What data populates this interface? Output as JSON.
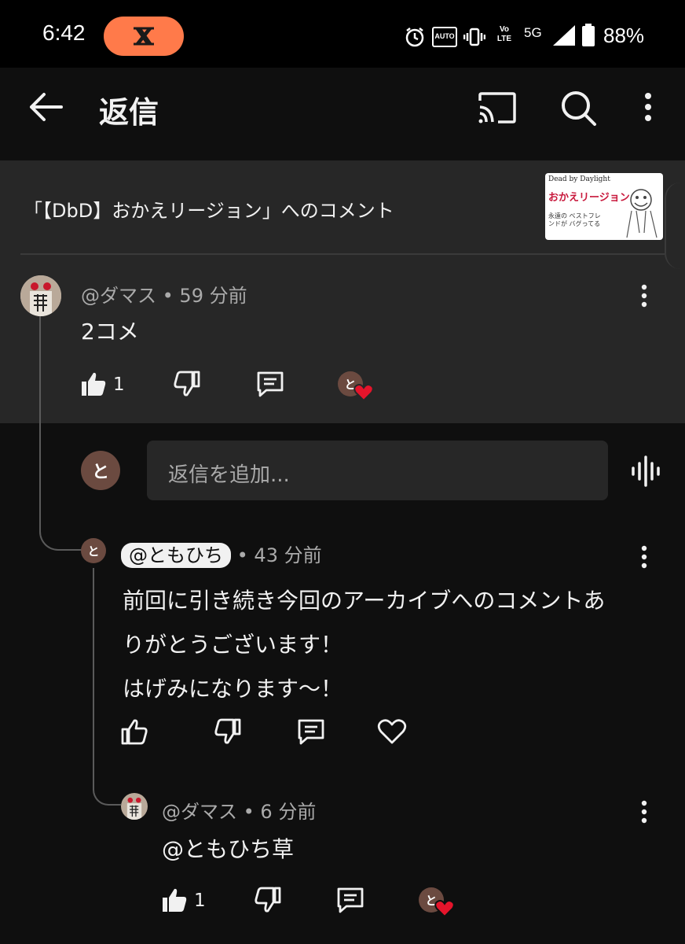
{
  "status_bar": {
    "time": "6:42",
    "battery": "88%",
    "icons": [
      "x-app-icon",
      "alarm-icon",
      "auto-hz-icon",
      "vibrate-icon",
      "volte-icon",
      "5g-icon",
      "signal-icon",
      "battery-icon"
    ],
    "network_label": "5G",
    "auto_label": "AUTO",
    "volte_label": "Vo LTE",
    "pill_color": "#ff7a4a"
  },
  "app_bar": {
    "title": "返信",
    "icons": [
      "back-arrow-icon",
      "cast-icon",
      "search-icon",
      "more-vert-icon"
    ]
  },
  "video_header": {
    "caption": "「【DbD】おかえリージョン」へのコメント",
    "thumbnail": {
      "game_label": "Dead by Daylight",
      "title": "おかえリージョン",
      "subtitle": "永遠の ベストフレンドが バグってる"
    }
  },
  "main_comment": {
    "author": "@ダマス",
    "time": "59 分前",
    "text": "2コメ",
    "likes": "1"
  },
  "reply_input": {
    "avatar_letter": "と",
    "placeholder": "返信を追加..."
  },
  "replies": [
    {
      "author": "@ともひち",
      "time": "43 分前",
      "avatar_letter": "と",
      "lines": [
        "前回に引き続き今回のアーカイブへのコメントあ",
        "りがとうございます！",
        "はげみになります〜！"
      ]
    },
    {
      "author": "@ダマス",
      "time": "6 分前",
      "text": "@ともひち草",
      "likes": "1"
    }
  ],
  "colors": {
    "background": "#0f0f0f",
    "highlight": "#272727",
    "heart": "#e5142b",
    "meta_text": "#aaaaaa"
  }
}
